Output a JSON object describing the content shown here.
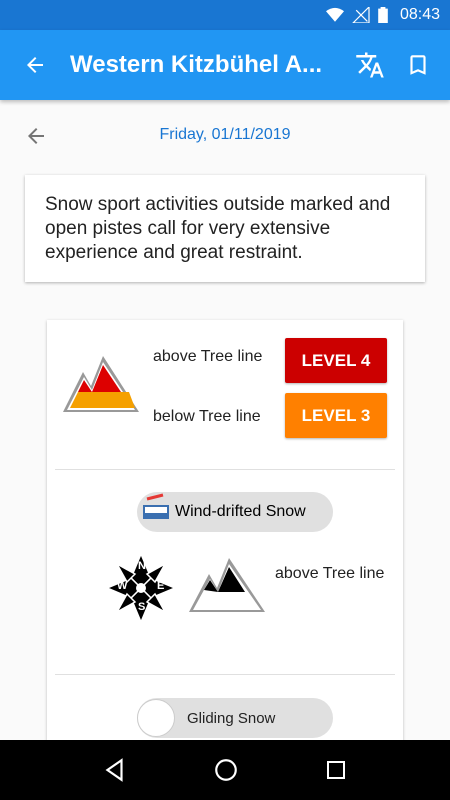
{
  "status_bar": {
    "time": "08:43",
    "icons": [
      "wifi-icon",
      "signal-icon",
      "battery-icon"
    ]
  },
  "app_bar": {
    "title": "Western Kitzbühel A...",
    "back_icon": "arrow-back-icon",
    "actions": [
      "translate-icon",
      "bookmark-icon"
    ]
  },
  "date_nav": {
    "date": "Friday, 01/11/2019",
    "back_icon": "arrow-back-icon"
  },
  "notice": {
    "text": "Snow sport activities outside marked and open pistes call for very extensive experience and great restraint."
  },
  "danger": {
    "above_label": "above Tree line",
    "below_label": "below Tree line",
    "above_level": "LEVEL 4",
    "below_level": "LEVEL 3",
    "colors": {
      "level4": "#cc0000",
      "level3": "#ff8000"
    }
  },
  "problems": [
    {
      "name": "Wind-drifted Snow",
      "compass": [
        "N",
        "E",
        "S",
        "W"
      ],
      "elevation_label": "above Tree line"
    },
    {
      "name": "Gliding Snow"
    }
  ],
  "colors": {
    "primary": "#2196f3",
    "primary_dark": "#1976d2"
  }
}
